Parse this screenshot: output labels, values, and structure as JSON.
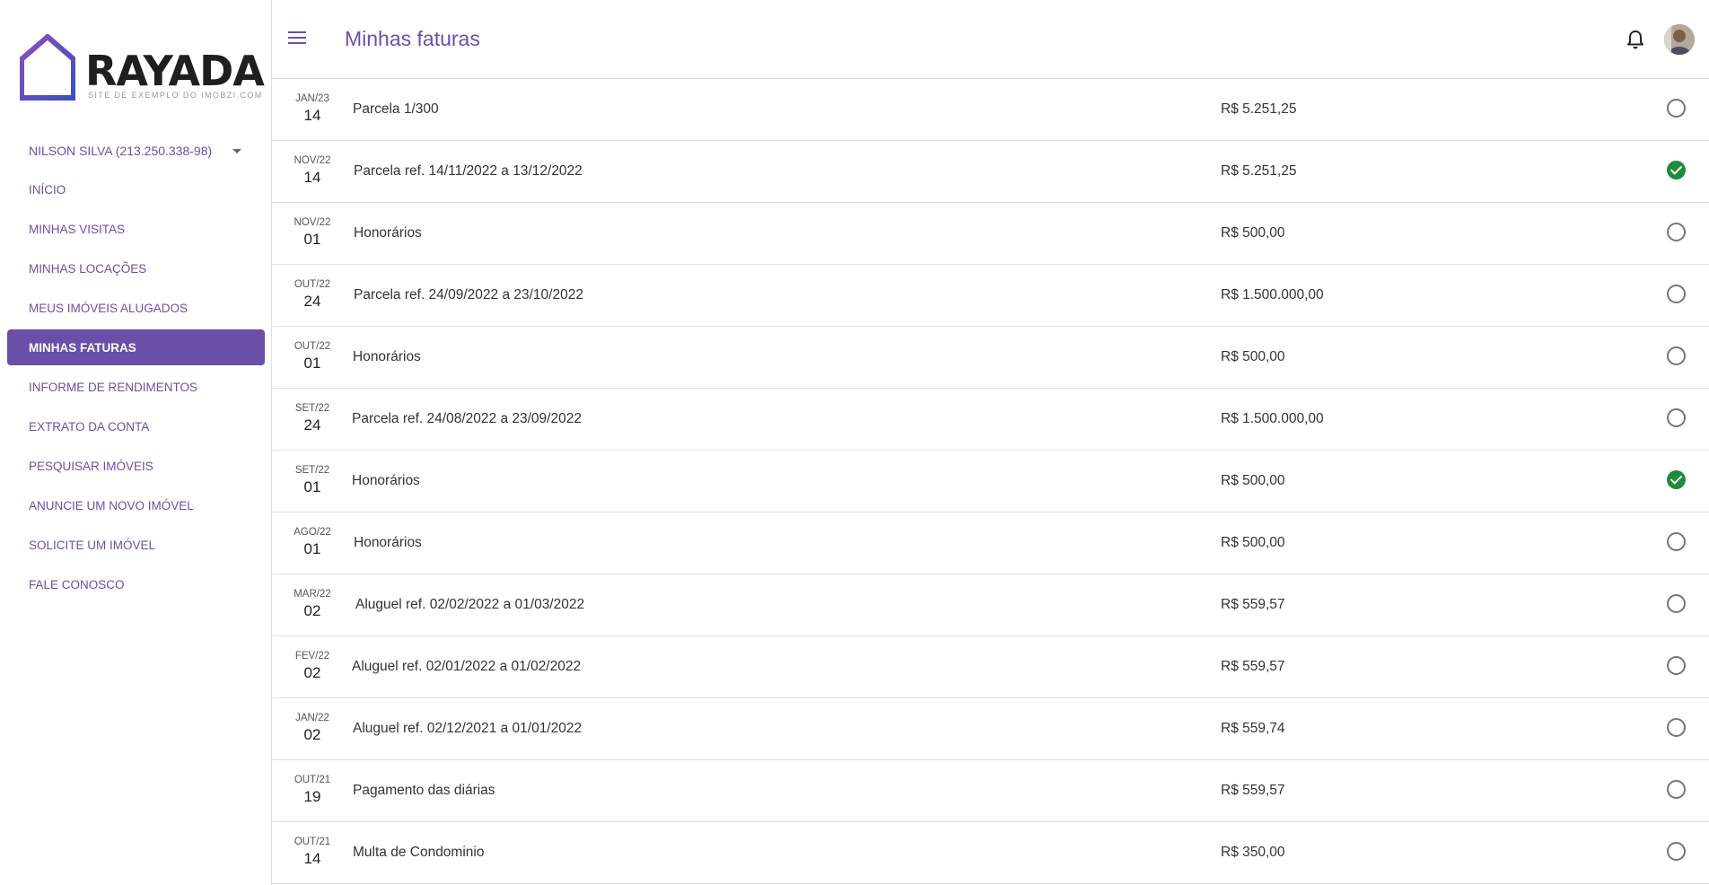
{
  "brand": {
    "name": "RAYADA",
    "tagline": "SITE DE EXEMPLO DO IMOBZI.COM",
    "accent": "#6a4fa9"
  },
  "user": {
    "label": "NILSON SILVA (213.250.338-98)"
  },
  "nav": {
    "items": [
      {
        "label": "INÍCIO"
      },
      {
        "label": "MINHAS VISITAS"
      },
      {
        "label": "MINHAS LOCAÇÕES"
      },
      {
        "label": "MEUS IMÓVEIS ALUGADOS"
      },
      {
        "label": "MINHAS FATURAS",
        "active": true
      },
      {
        "label": "INFORME DE RENDIMENTOS"
      },
      {
        "label": "EXTRATO DA CONTA"
      },
      {
        "label": "PESQUISAR IMÓVEIS"
      },
      {
        "label": "ANUNCIE UM NOVO IMÓVEL"
      },
      {
        "label": "SOLICITE UM IMÓVEL"
      },
      {
        "label": "FALE CONOSCO"
      }
    ]
  },
  "header": {
    "title": "Minhas faturas",
    "menu_icon": "menu-icon",
    "bell_icon": "bell-icon"
  },
  "invoices": [
    {
      "month": "JAN/23",
      "day": "14",
      "description": "Parcela 1/300",
      "amount": "R$ 5.251,25",
      "paid": false
    },
    {
      "month": "NOV/22",
      "day": "14",
      "description": "Parcela ref. 14/11/2022 a 13/12/2022",
      "amount": "R$ 5.251,25",
      "paid": true
    },
    {
      "month": "NOV/22",
      "day": "01",
      "description": "Honorários",
      "amount": "R$ 500,00",
      "paid": false
    },
    {
      "month": "OUT/22",
      "day": "24",
      "description": "Parcela ref. 24/09/2022 a 23/10/2022",
      "amount": "R$ 1.500.000,00",
      "paid": false
    },
    {
      "month": "OUT/22",
      "day": "01",
      "description": "Honorários",
      "amount": "R$ 500,00",
      "paid": false
    },
    {
      "month": "SET/22",
      "day": "24",
      "description": "Parcela ref. 24/08/2022 a 23/09/2022",
      "amount": "R$ 1.500.000,00",
      "paid": false
    },
    {
      "month": "SET/22",
      "day": "01",
      "description": "Honorários",
      "amount": "R$ 500,00",
      "paid": true
    },
    {
      "month": "AGO/22",
      "day": "01",
      "description": "Honorários",
      "amount": "R$ 500,00",
      "paid": false
    },
    {
      "month": "MAR/22",
      "day": "02",
      "description": "Aluguel ref. 02/02/2022 a 01/03/2022",
      "amount": "R$ 559,57",
      "paid": false
    },
    {
      "month": "FEV/22",
      "day": "02",
      "description": "Aluguel ref. 02/01/2022 a 01/02/2022",
      "amount": "R$ 559,57",
      "paid": false
    },
    {
      "month": "JAN/22",
      "day": "02",
      "description": "Aluguel ref. 02/12/2021 a 01/01/2022",
      "amount": "R$ 559,74",
      "paid": false
    },
    {
      "month": "OUT/21",
      "day": "19",
      "description": "Pagamento das diárias",
      "amount": "R$ 559,57",
      "paid": false
    },
    {
      "month": "OUT/21",
      "day": "14",
      "description": "Multa de Condominio",
      "amount": "R$ 350,00",
      "paid": false
    }
  ],
  "colors": {
    "paid": "#1e8c3a",
    "unpaid": "#757575"
  }
}
